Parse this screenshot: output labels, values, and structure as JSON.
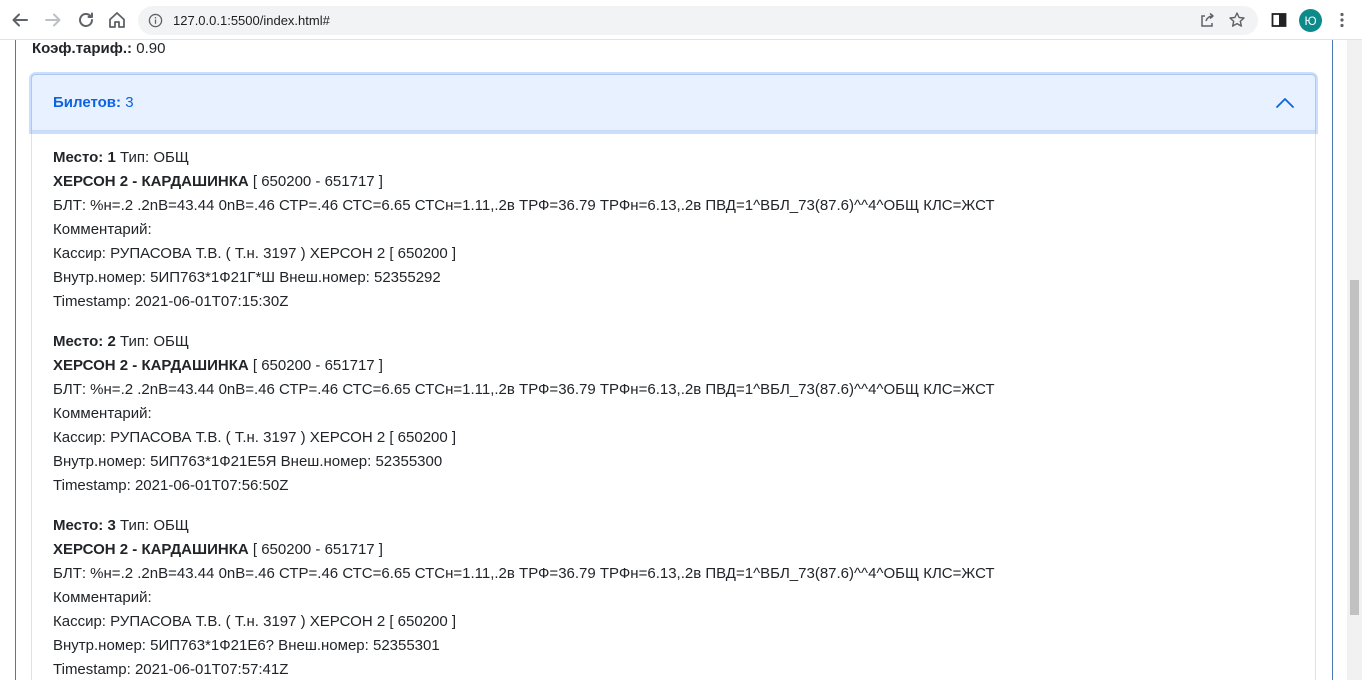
{
  "browser": {
    "url": "127.0.0.1:5500/index.html#",
    "profile_initial": "Ю"
  },
  "page": {
    "koef_label": "Коэф.тариф.:",
    "koef_value": "0.90",
    "tickets_label": "Билетов:",
    "tickets_count": "3"
  },
  "tickets": [
    {
      "seat_label": "Место:",
      "seat_no": "1",
      "type_text": "Тип: ОБЩ",
      "route": "ХЕРСОН 2 - КАРДАШИНКА",
      "route_codes": "[ 650200 - 651717 ]",
      "blt": "БЛТ: %н=.2 .2nВ=43.44 0nВ=.46 СТР=.46 СТС=6.65 СТСн=1.11,.2в ТРФ=36.79 ТРФн=6.13,.2в ПВД=1^ВБЛ_73(87.6)^^4^ОБЩ КЛС=ЖСТ",
      "comment": "Комментарий:",
      "cashier": "Кассир: РУПАСОВА Т.В. ( Т.н. 3197 ) ХЕРСОН 2 [ 650200 ]",
      "numbers": "Внутр.номер: 5ИП763*1Ф21Г*Ш Внеш.номер: 52355292",
      "timestamp": "Timestamp: 2021-06-01T07:15:30Z"
    },
    {
      "seat_label": "Место:",
      "seat_no": "2",
      "type_text": "Тип: ОБЩ",
      "route": "ХЕРСОН 2 - КАРДАШИНКА",
      "route_codes": "[ 650200 - 651717 ]",
      "blt": "БЛТ: %н=.2 .2nВ=43.44 0nВ=.46 СТР=.46 СТС=6.65 СТСн=1.11,.2в ТРФ=36.79 ТРФн=6.13,.2в ПВД=1^ВБЛ_73(87.6)^^4^ОБЩ КЛС=ЖСТ",
      "comment": "Комментарий:",
      "cashier": "Кассир: РУПАСОВА Т.В. ( Т.н. 3197 ) ХЕРСОН 2 [ 650200 ]",
      "numbers": "Внутр.номер: 5ИП763*1Ф21Е5Я Внеш.номер: 52355300",
      "timestamp": "Timestamp: 2021-06-01T07:56:50Z"
    },
    {
      "seat_label": "Место:",
      "seat_no": "3",
      "type_text": "Тип: ОБЩ",
      "route": "ХЕРСОН 2 - КАРДАШИНКА",
      "route_codes": "[ 650200 - 651717 ]",
      "blt": "БЛТ: %н=.2 .2nВ=43.44 0nВ=.46 СТР=.46 СТС=6.65 СТСн=1.11,.2в ТРФ=36.79 ТРФн=6.13,.2в ПВД=1^ВБЛ_73(87.6)^^4^ОБЩ КЛС=ЖСТ",
      "comment": "Комментарий:",
      "cashier": "Кассир: РУПАСОВА Т.В. ( Т.н. 3197 ) ХЕРСОН 2 [ 650200 ]",
      "numbers": "Внутр.номер: 5ИП763*1Ф21Е6? Внеш.номер: 52355301",
      "timestamp": "Timestamp: 2021-06-01T07:57:41Z"
    }
  ]
}
